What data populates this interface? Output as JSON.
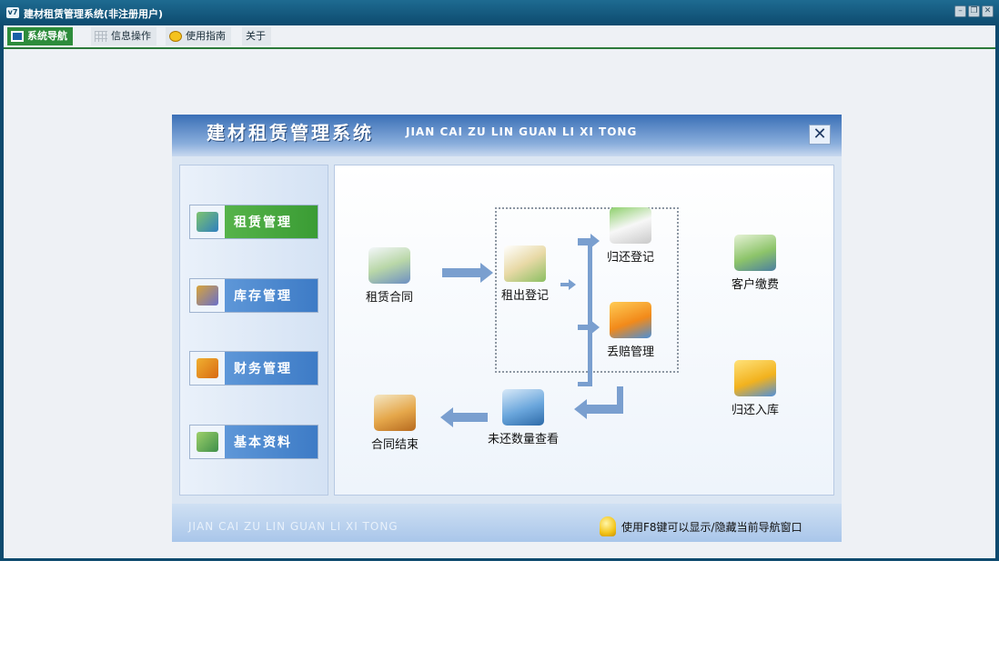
{
  "window": {
    "title": "建材租赁管理系统(非注册用户)",
    "icon_label": "v7"
  },
  "tabs": [
    {
      "label": "系统导航",
      "icon": "monitor-icon",
      "active": true
    },
    {
      "label": "信息操作",
      "icon": "grid-icon",
      "active": false
    },
    {
      "label": "使用指南",
      "icon": "smiley-icon",
      "active": false
    },
    {
      "label": "关于",
      "icon": "",
      "active": false
    }
  ],
  "panel": {
    "title_cn": "建材租赁管理系统",
    "title_en": "JIAN CAI ZU LIN GUAN LI XI TONG",
    "close_label": "✕",
    "footer_en": "JIAN CAI ZU LIN GUAN LI XI TONG",
    "hint": "使用F8键可以显示/隐藏当前导航窗口"
  },
  "modules": [
    {
      "label": "租赁管理",
      "color": "#3a9c34"
    },
    {
      "label": "库存管理",
      "color": "#3d7bc6"
    },
    {
      "label": "财务管理",
      "color": "#3d7bc6"
    },
    {
      "label": "基本资料",
      "color": "#3d7bc6"
    }
  ],
  "flow": {
    "lease_contract": "租赁合同",
    "rent_out": "租出登记",
    "return_register": "归还登记",
    "loss_management": "丢赔管理",
    "customer_payment": "客户缴费",
    "return_stock": "归还入库",
    "unreturned_query": "未还数量查看",
    "contract_close": "合同结束"
  }
}
